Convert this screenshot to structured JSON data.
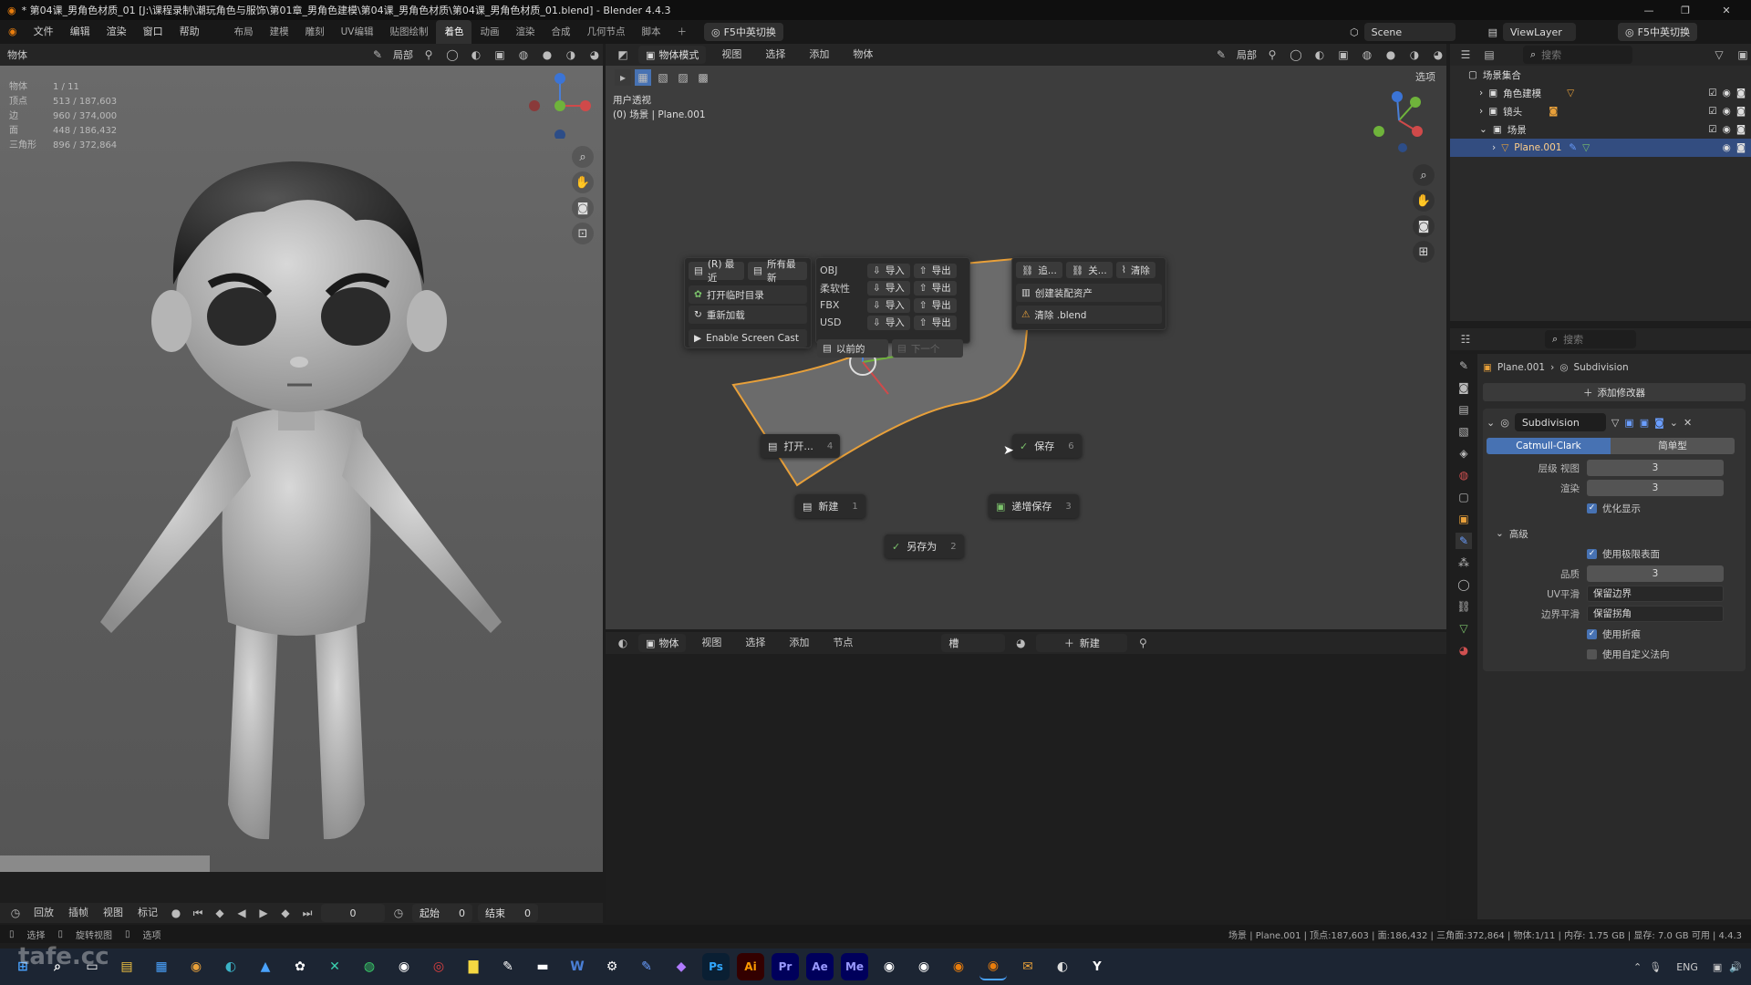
{
  "title_bar": {
    "text": "* 第04课_男角色材质_01 [J:\\课程录制\\潮玩角色与服饰\\第01章_男角色建模\\第04课_男角色材质\\第04课_男角色材质_01.blend] - Blender 4.4.3"
  },
  "menu": [
    "文件",
    "编辑",
    "渲染",
    "窗口",
    "帮助"
  ],
  "workspaces": [
    "布局",
    "建模",
    "雕刻",
    "UV编辑",
    "贴图绘制",
    "着色",
    "动画",
    "渲染",
    "合成",
    "几何节点",
    "脚本"
  ],
  "active_workspace": "着色",
  "input_switch": "F5中英切换",
  "scene_name": "Scene",
  "view_layer": "ViewLayer",
  "left_viewport": {
    "mode": "物体",
    "transform": "局部",
    "stats": [
      {
        "label": "物体",
        "value": "1 / 11"
      },
      {
        "label": "顶点",
        "value": "513 / 187,603"
      },
      {
        "label": "边",
        "value": "960 / 374,000"
      },
      {
        "label": "面",
        "value": "448 / 186,432"
      },
      {
        "label": "三角形",
        "value": "896 / 372,864"
      }
    ]
  },
  "mid_viewport": {
    "mode": "物体模式",
    "menus": [
      "视图",
      "选择",
      "添加",
      "物体"
    ],
    "transform": "局部",
    "options": "选项",
    "view_name": "用户透视",
    "collection": "(0) 场景 | Plane.001"
  },
  "file_popup": {
    "recent": "(R) 最近",
    "all_recent": "所有最新",
    "open_temp": "打开临时目录",
    "reload": "重新加载",
    "screencast": "Enable Screen Cast",
    "formats": [
      {
        "name": "OBJ",
        "import": "导入",
        "export": "导出"
      },
      {
        "name": "柔软性",
        "import": "导入",
        "export": "导出"
      },
      {
        "name": "FBX",
        "import": "导入",
        "export": "导出"
      },
      {
        "name": "USD",
        "import": "导入",
        "export": "导出"
      }
    ],
    "previous": "以前的",
    "next": "下一个",
    "append": "追...",
    "link": "关...",
    "clean": "清除",
    "create_asset": "创建装配资产",
    "clean_blend": "清除 .blend"
  },
  "pie_menu": [
    {
      "label": "打开...",
      "num": "4"
    },
    {
      "label": "保存",
      "num": "6"
    },
    {
      "label": "新建",
      "num": "1"
    },
    {
      "label": "递增保存",
      "num": "3"
    },
    {
      "label": "另存为",
      "num": "2"
    }
  ],
  "node_editor": {
    "mode": "物体",
    "menus": [
      "视图",
      "选择",
      "添加",
      "节点"
    ],
    "slot": "槽",
    "new_button": "新建"
  },
  "timeline": {
    "menus": [
      "回放",
      "插帧",
      "视图",
      "标记"
    ],
    "current_frame": "0",
    "start_label": "起始",
    "start": "0",
    "end_label": "结束",
    "end": "0"
  },
  "status_bar": {
    "left": [
      "选择",
      "旋转视图",
      "选项"
    ],
    "right": "场景 | Plane.001 | 顶点:187,603 | 面:186,432 | 三角面:372,864 | 物体:1/11 | 内存: 1.75 GB | 显存: 7.0 GB 可用 | 4.4.3"
  },
  "outliner": {
    "search_placeholder": "搜索",
    "root": "场景集合",
    "items": [
      {
        "label": "角色建模",
        "indent": 1,
        "selected": false
      },
      {
        "label": "镜头",
        "indent": 1,
        "selected": false
      },
      {
        "label": "场景",
        "indent": 1,
        "selected": false
      },
      {
        "label": "Plane.001",
        "indent": 2,
        "selected": true
      }
    ]
  },
  "properties": {
    "search_placeholder": "搜索",
    "object": "Plane.001",
    "modifier_crumb": "Subdivision",
    "add_modifier": "添加修改器",
    "modifier_name": "Subdivision",
    "tabs": [
      "Catmull-Clark",
      "简单型"
    ],
    "levels_label": "层级 视图",
    "levels_viewport": "3",
    "render_label": "渲染",
    "render_value": "3",
    "optimal_display": "优化显示",
    "advanced": "高级",
    "use_limit_surface": "使用极限表面",
    "quality_label": "品质",
    "quality": "3",
    "uv_smooth_label": "UV平滑",
    "uv_smooth": "保留边界",
    "boundary_smooth_label": "边界平滑",
    "boundary_smooth": "保留拐角",
    "use_creases": "使用折痕",
    "use_custom_normals": "使用自定义法向"
  },
  "taskbar": {
    "apps": [
      "Ps",
      "Ai",
      "Pr",
      "Ae",
      "Me",
      "Y"
    ],
    "lang": "ENG",
    "watermark": "tafe.cc"
  },
  "colors": {
    "accent": "#4772b3",
    "selected_row": "#334d80",
    "orange": "#e8a03a"
  }
}
